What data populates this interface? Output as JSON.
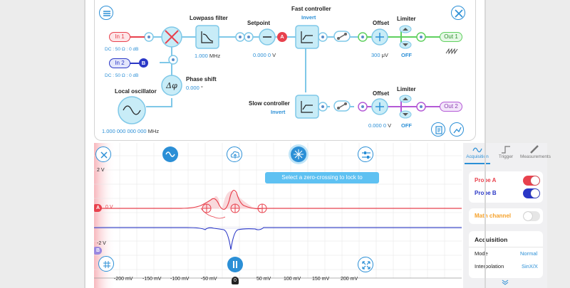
{
  "colors": {
    "accent": "#2b8fd6",
    "probe_a": "#e8414d",
    "probe_b": "#2a37c6",
    "math": "#f5a12a",
    "out_green": "#5fd05f",
    "out_purple": "#b45ad6",
    "pill_red": "#e8414d",
    "pill_blue": "#2a37c6",
    "node_fill": "#c8ecf7"
  },
  "icons": {
    "menu": "menu-icon",
    "tools": "tools-icon",
    "notes": "notes-icon",
    "chart": "chart-icon"
  },
  "inputs": {
    "in1": {
      "label": "In 1",
      "dc": "DC : 50 Ω : 0 dB"
    },
    "in2": {
      "label": "In 2",
      "badge": "B",
      "dc": "DC : 50 Ω : 0 dB"
    }
  },
  "lowpass": {
    "title": "Lowpass filter",
    "value": "1.000",
    "unit": "MHz"
  },
  "setpoint": {
    "title": "Setpoint",
    "value": "0.000 0",
    "unit": "V",
    "badge": "A"
  },
  "fast": {
    "title": "Fast controller",
    "mode": "Invert"
  },
  "slow": {
    "title": "Slow controller",
    "mode": "Invert"
  },
  "offset1": {
    "title": "Offset",
    "value": "300",
    "unit": "μV"
  },
  "offset2": {
    "title": "Offset",
    "value": "0.000 0",
    "unit": "V"
  },
  "limiter1": {
    "title": "Limiter",
    "state": "OFF"
  },
  "limiter2": {
    "title": "Limiter",
    "state": "OFF"
  },
  "out1": {
    "label": "Out 1"
  },
  "out2": {
    "label": "Out 2"
  },
  "phase": {
    "title": "Phase shift",
    "value": "0.000",
    "unit": "°"
  },
  "oscillator": {
    "title": "Local oscillator",
    "value": "1.000 000 000 000",
    "unit": "MHz"
  },
  "scope": {
    "toast": "Select a zero-crossing to lock to",
    "y_top": "2 V",
    "y_bottom": "-2 V",
    "marker_a": "A",
    "marker_a_label": "0 V",
    "marker_b": "B",
    "zero_marker": "0",
    "x_ticks": [
      "-200 mV",
      "-150 mV",
      "-100 mV",
      "-50 mV",
      "50 mV",
      "100 mV",
      "150 mV",
      "200 mV"
    ]
  },
  "side": {
    "tabs": [
      "Acquisition",
      "Trigger",
      "Measurements"
    ],
    "probe_a": {
      "label": "Probe A",
      "on": true
    },
    "probe_b": {
      "label": "Probe B",
      "on": true
    },
    "math": {
      "label": "Math channel",
      "on": false
    },
    "acq_title": "Acquisition",
    "mode_label": "Mode",
    "mode_value": "Normal",
    "interp_label": "Interpolation",
    "interp_value": "SinX/X"
  }
}
